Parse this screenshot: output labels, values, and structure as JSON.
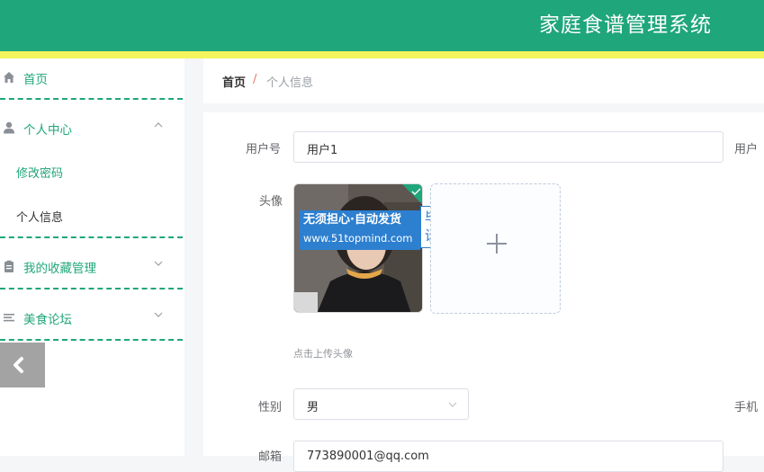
{
  "app": {
    "title": "家庭食谱管理系统"
  },
  "sidebar": {
    "items": [
      {
        "label": "首页",
        "icon": "home-icon"
      },
      {
        "label": "个人中心",
        "icon": "user-icon",
        "expanded": true,
        "children": [
          {
            "label": "修改密码"
          },
          {
            "label": "个人信息",
            "active": true
          }
        ]
      },
      {
        "label": "我的收藏管理",
        "icon": "clipboard-icon"
      },
      {
        "label": "美食论坛",
        "icon": "menu-lines-icon"
      }
    ]
  },
  "breadcrumb": {
    "home": "首页",
    "separator": "/",
    "current": "个人信息"
  },
  "form": {
    "username_label": "用户号",
    "username_value": "用户1",
    "username_right_label": "用户",
    "avatar_label": "头像",
    "avatar_caption_line1": "无须担心·自动发货",
    "avatar_caption_line2": "www.51topmind.com",
    "avatar_badge": "毕业设计",
    "upload_hint": "点击上传头像",
    "gender_label": "性别",
    "gender_value": "男",
    "phone_label": "手机",
    "email_label": "邮箱",
    "email_value": "773890001@qq.com"
  },
  "colors": {
    "primary": "#1fa67a",
    "accent_line": "#f4f45c"
  }
}
